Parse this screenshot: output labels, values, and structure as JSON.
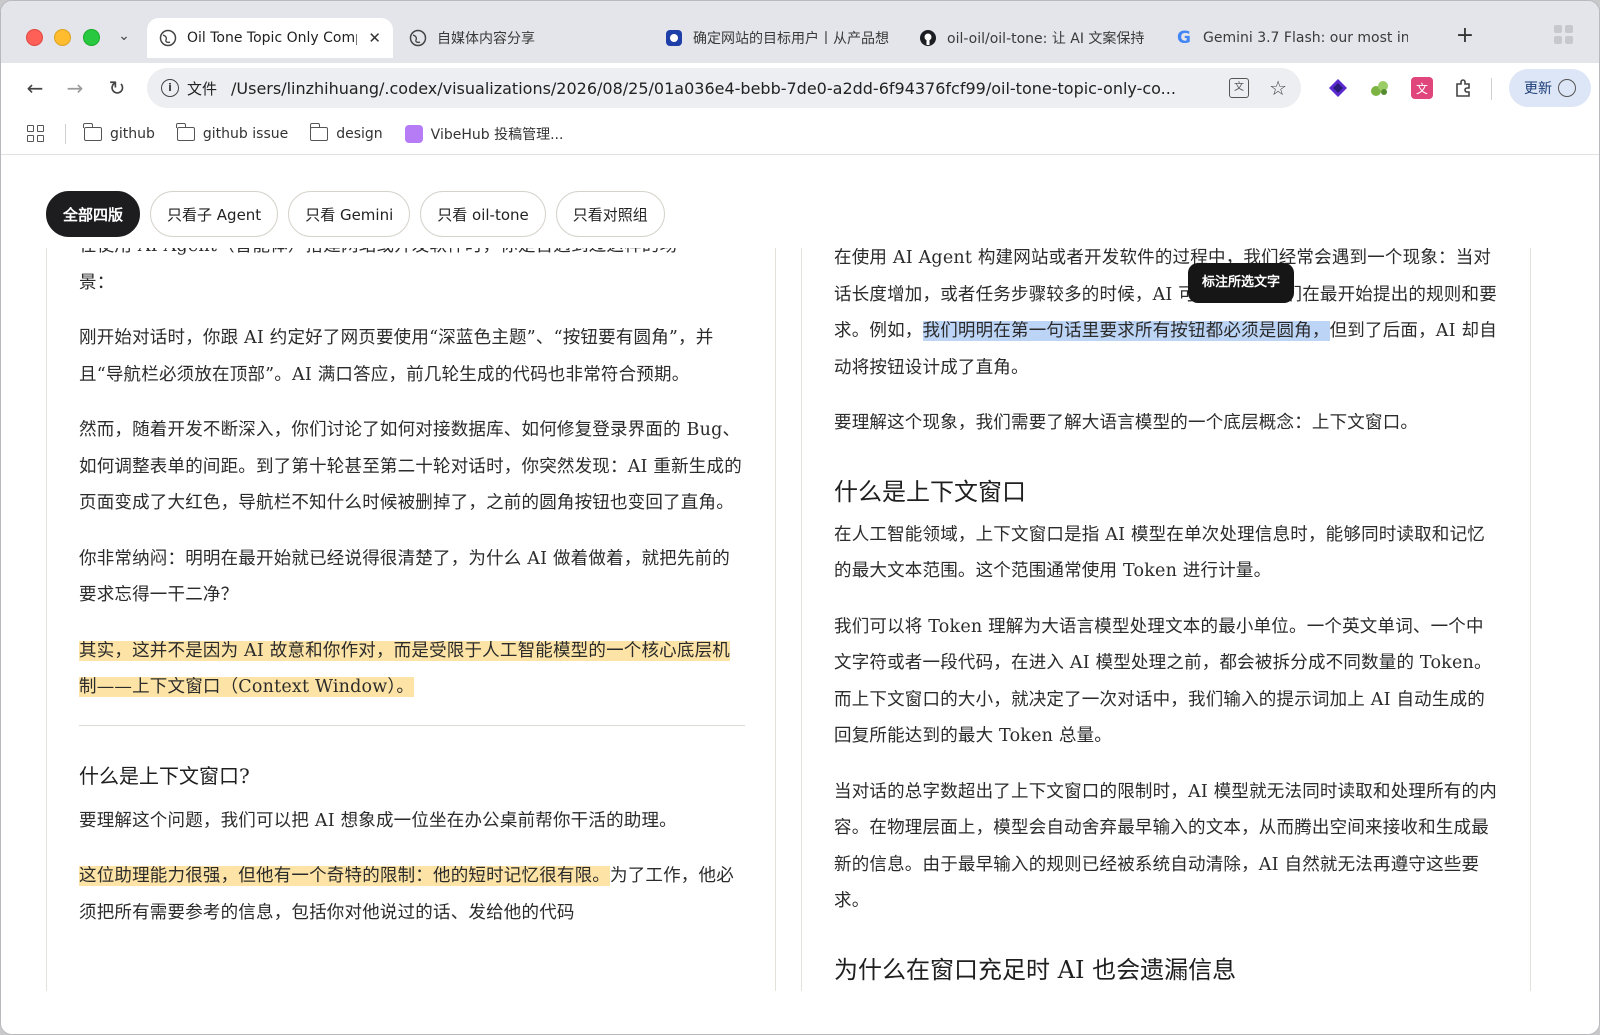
{
  "tabs": [
    {
      "title": "Oil Tone Topic Only Comp",
      "icon": "globe-icon",
      "active": true,
      "close": "✕"
    },
    {
      "title": "自媒体内容分享",
      "icon": "globe-icon",
      "active": false
    },
    {
      "title": "确定网站的目标用户丨从产品想",
      "icon": "app-icon",
      "active": false
    },
    {
      "title": "oil-oil/oil-tone: 让 AI 文案保持",
      "icon": "github-icon",
      "active": false
    },
    {
      "title": "Gemini 3.7 Flash: our most in",
      "icon": "google-icon",
      "active": false
    }
  ],
  "toolbar": {
    "scheme": "文件",
    "url": "/Users/linzhihuang/.codex/visualizations/2026/08/25/01a036e4-bebb-7de0-a2dd-6f94376fcf99/oil-tone-topic-only-co...",
    "update_label": "更新"
  },
  "bookmarks": [
    "github",
    "github issue",
    "design",
    "VibeHub 投稿管理..."
  ],
  "filters": [
    "全部四版",
    "只看子 Agent",
    "只看 Gemini",
    "只看 oil-tone",
    "只看对照组"
  ],
  "left": {
    "top_line": "在使用 AI Agent（智能体）搭建网站或开发软件时，你是否遇到过这样的场",
    "p0_end": "景：",
    "p1": "刚开始对话时，你跟 AI 约定好了网页要使用“深蓝色主题”、“按钮要有圆角”，并且“导航栏必须放在顶部”。AI 满口答应，前几轮生成的代码也非常符合预期。",
    "p2": "然而，随着开发不断深入，你们讨论了如何对接数据库、如何修复登录界面的 Bug、如何调整表单的间距。到了第十轮甚至第二十轮对话时，你突然发现：AI 重新生成的页面变成了大红色，导航栏不知什么时候被删掉了，之前的圆角按钮也变回了直角。",
    "p3": "你非常纳闷：明明在最开始就已经说得很清楚了，为什么 AI 做着做着，就把先前的要求忘得一干二净？",
    "p4_highlight": "其实，这并不是因为 AI 故意和你作对，而是受限于人工智能模型的一个核心底层机制——上下文窗口（Context Window）。",
    "h2": "什么是上下文窗口?",
    "p5": "要理解这个问题，我们可以把 AI 想象成一位坐在办公桌前帮你干活的助理。",
    "p6_highlight": "这位助理能力很强，但他有一个奇特的限制：他的短时记忆很有限。",
    "p6_rest": "为了工作，他必须把所有需要参考的信息，包括你对他说过的话、发给他的代码"
  },
  "right": {
    "p1_a": "在使用 AI Agent 构建网站或者开发软件的过程中，我们经常会遇到一个现象：当对话长度增加，或者任务步骤较多的时候，AI 可能会遗漏我们在最开始提出的规则和要求。例如，",
    "p1_highlight": "我们明明在第一句话里要求所有按钮都必须是圆角，",
    "p1_b": "但到了后面，AI 却自动将按钮设计成了直角。",
    "p2": "要理解这个现象，我们需要了解大语言模型的一个底层概念：上下文窗口。",
    "h2": "什么是上下文窗口",
    "p3": "在人工智能领域，上下文窗口是指 AI 模型在单次处理信息时，能够同时读取和记忆的最大文本范围。这个范围通常使用 Token 进行计量。",
    "p4": "我们可以将 Token 理解为大语言模型处理文本的最小单位。一个英文单词、一个中文字符或者一段代码，在进入 AI 模型处理之前，都会被拆分成不同数量的 Token。而上下文窗口的大小，就决定了一次对话中，我们输入的提示词加上 AI 自动生成的回复所能达到的最大 Token 总量。",
    "p5": "当对话的总字数超出了上下文窗口的限制时，AI 模型就无法同时读取和处理所有的内容。在物理层面上，模型会自动舍弃最早输入的文本，从而腾出空间来接收和生成最新的信息。由于最早输入的规则已经被系统自动清除，AI 自然就无法再遵守这些要求。",
    "h3": "为什么在窗口充足时 AI 也会遗漏信息"
  },
  "tooltip": "标注所选文字",
  "colors": {
    "highlight_yellow": "#fde4a6",
    "highlight_blue": "#bcd4f5",
    "chip_active": "#1d1d1f"
  }
}
